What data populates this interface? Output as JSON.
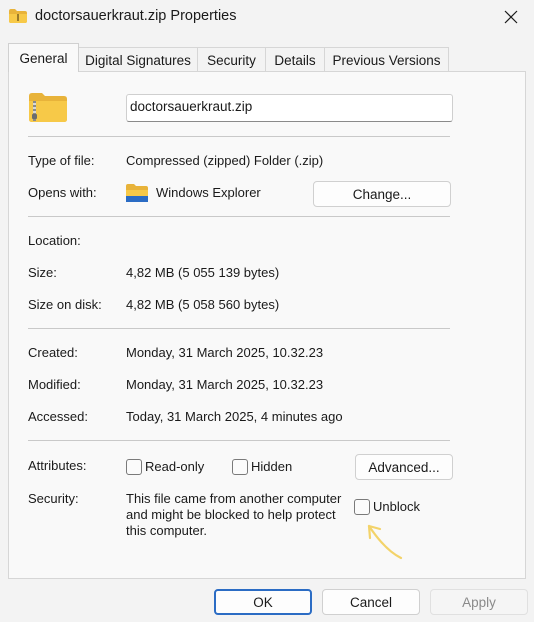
{
  "window": {
    "title": "doctorsauerkraut.zip Properties"
  },
  "tabs": [
    {
      "label": "General",
      "active": true
    },
    {
      "label": "Digital Signatures",
      "active": false
    },
    {
      "label": "Security",
      "active": false
    },
    {
      "label": "Details",
      "active": false
    },
    {
      "label": "Previous Versions",
      "active": false
    }
  ],
  "general": {
    "file_name": "doctorsauerkraut.zip",
    "type_label": "Type of file:",
    "type_value": "Compressed (zipped) Folder (.zip)",
    "opens_label": "Opens with:",
    "opens_value": "Windows Explorer",
    "change_button": "Change...",
    "location_label": "Location:",
    "location_value": "",
    "size_label": "Size:",
    "size_value": "4,82 MB (5 055 139 bytes)",
    "size_on_disk_label": "Size on disk:",
    "size_on_disk_value": "4,82 MB (5 058 560 bytes)",
    "created_label": "Created:",
    "created_value": "Monday, 31 March 2025, 10.32.23",
    "modified_label": "Modified:",
    "modified_value": "Monday, 31 March 2025, 10.32.23",
    "accessed_label": "Accessed:",
    "accessed_value": "Today, 31 March 2025, 4 minutes ago",
    "attributes_label": "Attributes:",
    "readonly_label": "Read-only",
    "readonly_checked": false,
    "hidden_label": "Hidden",
    "hidden_checked": false,
    "advanced_button": "Advanced...",
    "security_label": "Security:",
    "security_text": "This file came from another computer and might be blocked to help protect this computer.",
    "unblock_label": "Unblock",
    "unblock_checked": false
  },
  "footer": {
    "ok": "OK",
    "cancel": "Cancel",
    "apply": "Apply"
  },
  "icons": {
    "title_icon": "zip-folder-icon",
    "file_icon": "zip-folder-icon",
    "opens_icon": "explorer-folder-icon",
    "close_icon": "close-icon",
    "annotation": "arrow-annotation-icon"
  },
  "colors": {
    "accent": "#2b6cc4",
    "folder_yellow": "#f7c948",
    "annotation": "#f3d36a"
  }
}
